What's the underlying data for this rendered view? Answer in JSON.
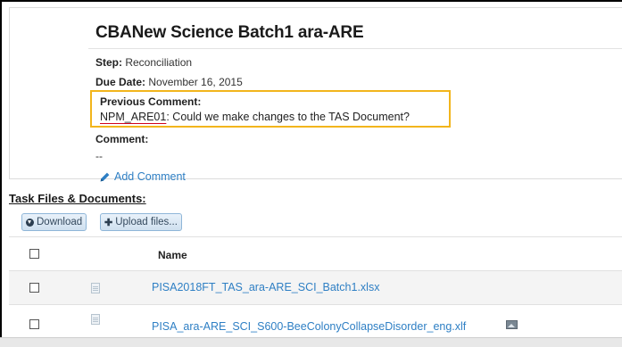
{
  "task": {
    "title": "CBANew Science Batch1 ara-ARE",
    "step_label": "Step:",
    "step_value": "Reconciliation",
    "due_label": "Due Date:",
    "due_value": "November 16, 2015",
    "previous_comment_label": "Previous Comment:",
    "previous_comment_author": "NPM_ARE01",
    "previous_comment_text": ": Could we make changes to the TAS Document?",
    "comment_label": "Comment:",
    "comment_value": "--",
    "add_comment_label": "Add Comment"
  },
  "files": {
    "heading": "Task Files & Documents:",
    "download_label": "Download",
    "upload_label": "Upload files...",
    "name_header": "Name",
    "rows": [
      {
        "name": "PISA2018FT_TAS_ara-ARE_SCI_Batch1.xlsx"
      },
      {
        "name": "PISA_ara-ARE_SCI_S600-BeeColonyCollapseDisorder_eng.xlf"
      }
    ]
  },
  "icons": {
    "add_comment": "pencil-icon",
    "download": "download-circle-icon",
    "upload": "plus-icon",
    "file": "document-icon",
    "image": "image-icon"
  },
  "colors": {
    "link": "#2e7fc4",
    "highlight_box": "#f2b51c",
    "author_underline": "#d0021b"
  }
}
